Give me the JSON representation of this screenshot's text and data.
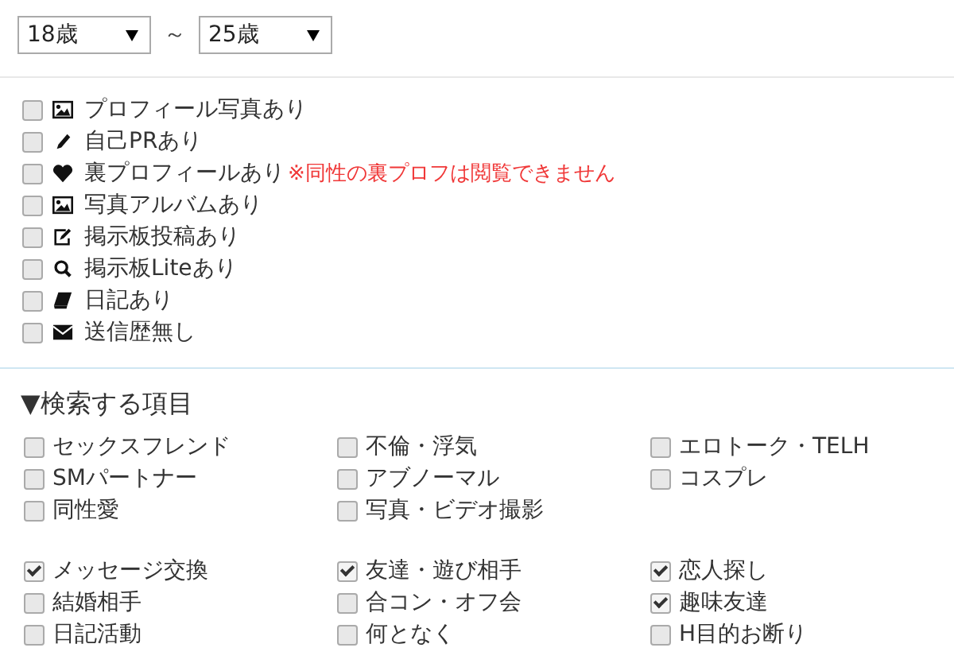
{
  "age_range": {
    "min": "18歳",
    "separator": "～",
    "max": "25歳"
  },
  "profile_filters": [
    {
      "kind": "picture",
      "label": "プロフィール写真あり",
      "checked": false
    },
    {
      "kind": "pencil",
      "label": "自己PRあり",
      "checked": false
    },
    {
      "kind": "heart",
      "label": "裏プロフィールあり",
      "checked": false,
      "note": "※同性の裏プロフは閲覧できません"
    },
    {
      "kind": "picture",
      "label": "写真アルバムあり",
      "checked": false
    },
    {
      "kind": "edit",
      "label": "掲示板投稿あり",
      "checked": false
    },
    {
      "kind": "search",
      "label": "掲示板Liteあり",
      "checked": false
    },
    {
      "kind": "book",
      "label": "日記あり",
      "checked": false
    },
    {
      "kind": "mail",
      "label": "送信歴無し",
      "checked": false
    }
  ],
  "search_items": {
    "heading": "▼検索する項目",
    "groups": [
      [
        {
          "label": "セックスフレンド",
          "checked": false
        },
        {
          "label": "不倫・浮気",
          "checked": false
        },
        {
          "label": "エロトーク・TELH",
          "checked": false
        },
        {
          "label": "SMパートナー",
          "checked": false
        },
        {
          "label": "アブノーマル",
          "checked": false
        },
        {
          "label": "コスプレ",
          "checked": false
        },
        {
          "label": "同性愛",
          "checked": false
        },
        {
          "label": "写真・ビデオ撮影",
          "checked": false
        }
      ],
      [
        {
          "label": "メッセージ交換",
          "checked": true
        },
        {
          "label": "友達・遊び相手",
          "checked": true
        },
        {
          "label": "恋人探し",
          "checked": true
        },
        {
          "label": "結婚相手",
          "checked": false
        },
        {
          "label": "合コン・オフ会",
          "checked": false
        },
        {
          "label": "趣味友達",
          "checked": true
        },
        {
          "label": "日記活動",
          "checked": false
        },
        {
          "label": "何となく",
          "checked": false
        },
        {
          "label": "H目的お断り",
          "checked": false
        }
      ]
    ]
  }
}
